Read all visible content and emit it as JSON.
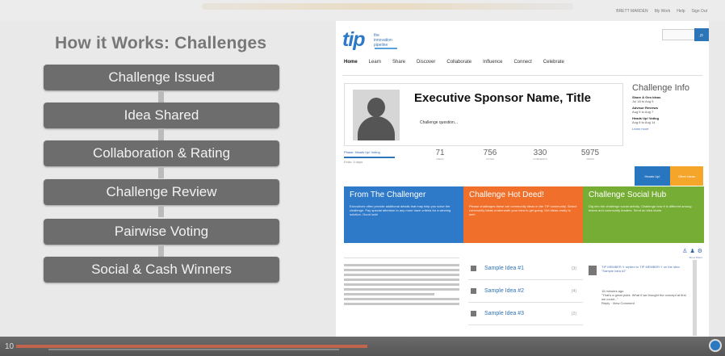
{
  "account": {
    "name": "BRETT MARDEN",
    "links": [
      "My Work",
      "Help",
      "Sign Out"
    ]
  },
  "slide": {
    "title": "How it Works: Challenges",
    "steps": [
      "Challenge Issued",
      "Idea Shared",
      "Collaboration & Rating",
      "Challenge Review",
      "Pairwise Voting",
      "Social & Cash Winners"
    ],
    "number": "10"
  },
  "site": {
    "logo": "tip",
    "logo_subtitle": [
      "the",
      "innovation",
      "pipeline"
    ],
    "nav": [
      "Home",
      "Learn",
      "Share",
      "Discover",
      "Collaborate",
      "Influence",
      "Connect",
      "Celebrate"
    ],
    "sponsor": {
      "title": "Executive Sponsor Name, Title",
      "question": "Challenge question..."
    },
    "challenge_info": {
      "heading": "Challenge Info",
      "items": [
        {
          "label": "Share & Gen Ideas",
          "dates": "Jul 18 to Aug 5"
        },
        {
          "label": "Advisor Reviews",
          "dates": "Aug 5 to Aug 7"
        },
        {
          "label": "Heads Up! Voting",
          "dates": "Aug 8 to Aug 14"
        }
      ],
      "learn_more": "Learn more"
    },
    "phase": {
      "label": "Phase: Heads Up! Voting",
      "ends": "Ends: 3 days",
      "progress": 0.9
    },
    "stats": [
      {
        "value": "71",
        "label": "IDEAS"
      },
      {
        "value": "756",
        "label": "VOTES"
      },
      {
        "value": "330",
        "label": "COMMENTS"
      },
      {
        "value": "5975",
        "label": "VIEWS"
      }
    ],
    "buttons": {
      "heads_up": "Heads Up!",
      "other_ideas": "Other Ideas"
    },
    "panels": [
      {
        "title": "From The Challenger",
        "text": "Executives often provide additional details that may help you solve the challenge. Pay special attention to any more have criteria for a winning solution. Good luck!",
        "color": "#2e79c8"
      },
      {
        "title": "Challenge Hot Deed!",
        "text": "Please challenges these are community ideas in the TIP community. Select community ideas underneath your idea to get going. Get ideas ready to see!",
        "color": "#f06f2a"
      },
      {
        "title": "Challenge Social Hub",
        "text": "Dig into the challenge social activity. Challenge how it is different among teams and community leaders. Send an idea share.",
        "color": "#76ad34"
      }
    ],
    "filter_link": "Show Filters",
    "ideas": [
      {
        "label": "Sample Idea #1",
        "count": "(3)"
      },
      {
        "label": "Sample Idea #2",
        "count": "(4)"
      },
      {
        "label": "Sample Idea #3",
        "count": "(2)"
      }
    ],
    "activity": {
      "headline": "TIP MEMBER X replied to TIP MEMBER Y on the idea \"Sample Idea #2\"",
      "time": "15 minutes ago",
      "quote": "\"That's a great point. What if we thought the concept at first we could...\"",
      "links": [
        "Reply",
        "View Comment"
      ]
    }
  },
  "colors": {
    "step": "#6d6d6d",
    "accent_blue": "#2e79c8",
    "accent_orange": "#f06f2a",
    "accent_green": "#76ad34"
  }
}
